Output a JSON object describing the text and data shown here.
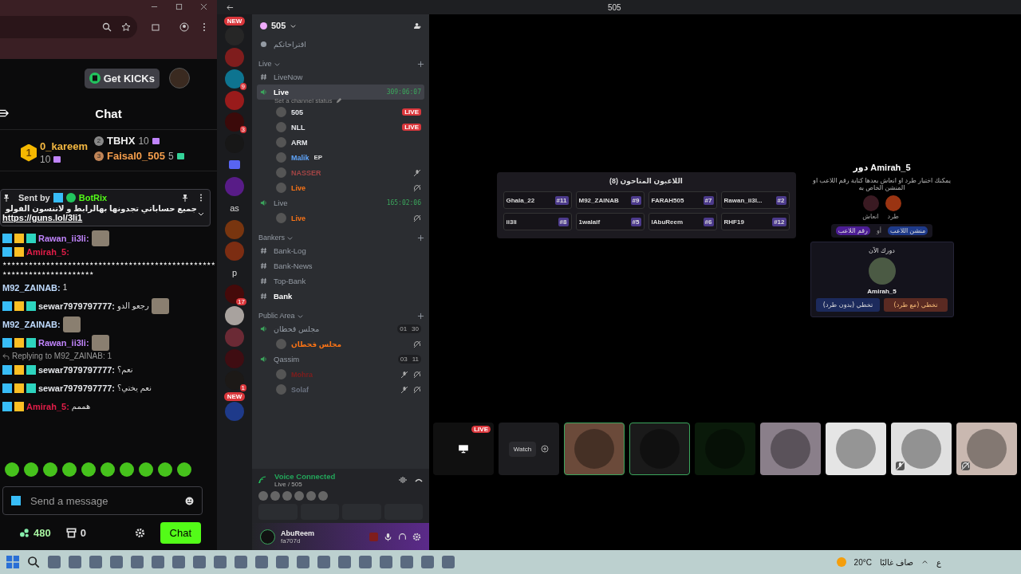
{
  "kick": {
    "get_button": "Get KICKs",
    "chat_title": "Chat",
    "leaders": [
      {
        "rank": "1",
        "name": "0_kareem",
        "count": "10",
        "color": "#c084fc"
      },
      {
        "rank": "2",
        "name": "TBHX",
        "count": "10",
        "color": "#c084fc"
      },
      {
        "rank": "3",
        "name": "Faisal0_505",
        "count": "5",
        "color": "#34d399"
      }
    ],
    "pinned": {
      "label": "Sent by",
      "author": "BotRix",
      "text": "جميع حساباتي تجدونها بهالرابط و لاتنسون الفولو",
      "link": "https://guns.lol/3li1"
    },
    "messages": [
      {
        "kind": "og",
        "user": "Rawan_ii3li:",
        "color": "#c084fc",
        "emote": true
      },
      {
        "kind": "vip",
        "user": "Amirah_5:",
        "color": "#e11d48",
        "text": "٭٭٭٭٭٭٭٭٭٭٭٭٭٭٭٭٭٭٭٭٭٭٭٭٭٭٭٭٭٭٭٭٭٭٭٭٭٭٭٭٭٭٭٭٭٭٭٭٭٭٭٭٭٭٭٭٭٭٭٭٭٭٭٭٭٭٭٭٭٭",
        "emote": false
      },
      {
        "kind": "plain",
        "user": "M92_ZAINAB:",
        "color": "#bfdbfe",
        "text": "1",
        "emote": false
      },
      {
        "kind": "og",
        "user": "sewar7979797777:",
        "color": "#e5e7eb",
        "text": "رجعو الدو",
        "emote": true
      },
      {
        "kind": "plain",
        "user": "M92_ZAINAB:",
        "color": "#bfdbfe",
        "emote": true
      },
      {
        "kind": "og",
        "user": "Rawan_ii3li:",
        "color": "#c084fc",
        "emote": true
      },
      {
        "kind": "og",
        "user": "sewar7979797777:",
        "color": "#e5e7eb",
        "text": "نعم؟",
        "reply": "Replying to M92_ZAINAB: 1",
        "emote": false
      },
      {
        "kind": "og",
        "user": "sewar7979797777:",
        "color": "#e5e7eb",
        "text": "نعم يختي؟",
        "emote": false
      },
      {
        "kind": "vip",
        "user": "Amirah_5:",
        "color": "#e11d48",
        "text": "هممم",
        "emote": false
      }
    ],
    "input": {
      "placeholder": "Send a message"
    },
    "points": "480",
    "store": "0",
    "chat_button": "Chat"
  },
  "discord": {
    "title": "505",
    "server_name": "505",
    "servers": [
      {
        "kind": "avatar",
        "color": "#262626",
        "tag": "NEW"
      },
      {
        "kind": "avatar",
        "color": "#7f1d1d"
      },
      {
        "kind": "avatar",
        "color": "#0e7490",
        "badge": "9"
      },
      {
        "kind": "avatar",
        "color": "#991b1b"
      },
      {
        "kind": "avatar",
        "color": "#3b0a0a",
        "badge": "3"
      },
      {
        "kind": "avatar",
        "color": "#171717"
      },
      {
        "kind": "folder"
      },
      {
        "kind": "avatar",
        "color": "#581c87"
      },
      {
        "kind": "text",
        "text": "as"
      },
      {
        "kind": "avatar",
        "color": "#78350f"
      },
      {
        "kind": "avatar",
        "color": "#7c2d12"
      },
      {
        "kind": "text",
        "text": "p"
      },
      {
        "kind": "avatar",
        "color": "#450a0a",
        "badge": "17"
      },
      {
        "kind": "avatar",
        "color": "#a8a29e"
      },
      {
        "kind": "avatar",
        "color": "#6b2a35"
      },
      {
        "kind": "avatar",
        "color": "#3f0d12"
      },
      {
        "kind": "avatar",
        "color": "#1c1917",
        "badge": "1"
      },
      {
        "kind": "avatar",
        "color": "#1e3a8a",
        "tag": "NEW"
      }
    ],
    "top_channel": "اقتراحاتكم",
    "categories": [
      {
        "name": "Live",
        "channels": [
          {
            "kind": "text",
            "name": "LiveNow",
            "selected": false,
            "unread": false
          },
          {
            "kind": "voice",
            "name": "Live",
            "selected": true,
            "timer": "309:06:07",
            "status": "Set a channel status",
            "members": [
              {
                "name": "505",
                "color": "#e5e7eb",
                "badge": "LIVE",
                "muted": false,
                "deafened": false
              },
              {
                "name": "NLL",
                "color": "#e5e7eb",
                "badge": "LIVE",
                "muted": false,
                "deafened": false
              },
              {
                "name": "ARM",
                "color": "#e5e7eb",
                "muted": false,
                "deafened": false
              },
              {
                "name": "Malik",
                "tag": "EP",
                "color": "#60a5fa",
                "muted": false,
                "deafened": false
              },
              {
                "name": "NASSER",
                "color": "#a34545",
                "muted": true,
                "deafened": false
              },
              {
                "name": "Live",
                "color": "#f97316",
                "muted": false,
                "deafened": true
              }
            ]
          },
          {
            "kind": "voice",
            "name": "Live",
            "selected": false,
            "timer": "165:02:06",
            "members": [
              {
                "name": "Live",
                "color": "#f97316",
                "muted": false,
                "deafened": true
              }
            ]
          }
        ]
      },
      {
        "name": "Bankers",
        "channels": [
          {
            "kind": "text",
            "name": "Bank-Log",
            "selected": false,
            "unread": false
          },
          {
            "kind": "text",
            "name": "Bank-News",
            "selected": false,
            "unread": false
          },
          {
            "kind": "text",
            "name": "Top-Bank",
            "selected": false,
            "unread": false
          },
          {
            "kind": "text",
            "name": "Bank",
            "selected": false,
            "unread": true
          }
        ]
      },
      {
        "name": "Public Area",
        "channels": [
          {
            "kind": "voice",
            "name": "مجلس قحطان",
            "selected": false,
            "count": "01",
            "limit": "30",
            "members": [
              {
                "name": "مجلس قحطان",
                "color": "#f97316",
                "muted": false,
                "deafened": true
              }
            ]
          },
          {
            "kind": "voice",
            "name": "Qassim",
            "selected": false,
            "count": "03",
            "limit": "11",
            "members": [
              {
                "name": "Mohra",
                "color": "#7f1d1d",
                "muted": true,
                "deafened": true
              },
              {
                "name": "Solaf",
                "color": "#6b7280",
                "muted": true,
                "deafened": true
              }
            ]
          }
        ]
      }
    ],
    "voice": {
      "status": "Voice Connected",
      "channel": "Live / 505"
    },
    "user": {
      "name": "AbuReem",
      "status": "fa707d"
    }
  },
  "game": {
    "players_title": "اللاعبون المتاحون (8)",
    "players": [
      {
        "name": "Ghala_22",
        "number": "#11"
      },
      {
        "name": "M92_ZAINAB",
        "number": "#9"
      },
      {
        "name": "FARAH505",
        "number": "#7"
      },
      {
        "name": "Rawan_ii3l...",
        "number": "#2"
      },
      {
        "name": "ii3li",
        "number": "#8"
      },
      {
        "name": "1walaif",
        "number": "#5"
      },
      {
        "name": "lAbuReem",
        "number": "#6"
      },
      {
        "name": "RHF19",
        "number": "#12"
      }
    ],
    "turn_title": "دور Amirah_5",
    "turn_hint": "يمكنك اختيار طرد او انعاش بعدها كتابة رقم اللاعب او المنشن الخاص به",
    "actions": [
      {
        "kind": "kick",
        "label": "طرد"
      },
      {
        "kind": "revive",
        "label": "انعاش"
      }
    ],
    "chips": [
      {
        "kind": "blue",
        "label": "منشن اللاعب"
      },
      {
        "kind": "plain",
        "label": "أو"
      },
      {
        "kind": "purple",
        "label": "رقم اللاعب"
      }
    ],
    "now_label": "دورك الآن",
    "now_player": "Amirah_5",
    "buttons": [
      {
        "kind": "brown",
        "label": "تخطي (مع طرد)"
      },
      {
        "kind": "blue",
        "label": "تخطي (بدون طرد)"
      }
    ]
  },
  "tiles": [
    {
      "kind": "stream",
      "badge": "LIVE"
    },
    {
      "kind": "watch",
      "label": "Watch"
    },
    {
      "kind": "avatar",
      "color": "#6b4a3a",
      "speaking": true,
      "muted": false,
      "deafened": false
    },
    {
      "kind": "avatar",
      "color": "#1a1a1a",
      "speaking": true,
      "muted": false,
      "deafened": false
    },
    {
      "kind": "avatar",
      "color": "#0a1a0a",
      "speaking": false,
      "muted": false,
      "deafened": false
    },
    {
      "kind": "avatar",
      "color": "#8a7f8a",
      "speaking": false,
      "muted": false,
      "deafened": false
    },
    {
      "kind": "avatar",
      "color": "#e5e5e5",
      "speaking": false,
      "muted": false,
      "deafened": false
    },
    {
      "kind": "avatar",
      "color": "#e0e0e0",
      "speaking": false,
      "muted": true,
      "deafened": false
    },
    {
      "kind": "avatar",
      "color": "#c9b8b0",
      "speaking": false,
      "muted": false,
      "deafened": true
    }
  ],
  "taskbar": {
    "temperature": "20°C",
    "weather": "صاف غالبًا",
    "language": "ع"
  }
}
